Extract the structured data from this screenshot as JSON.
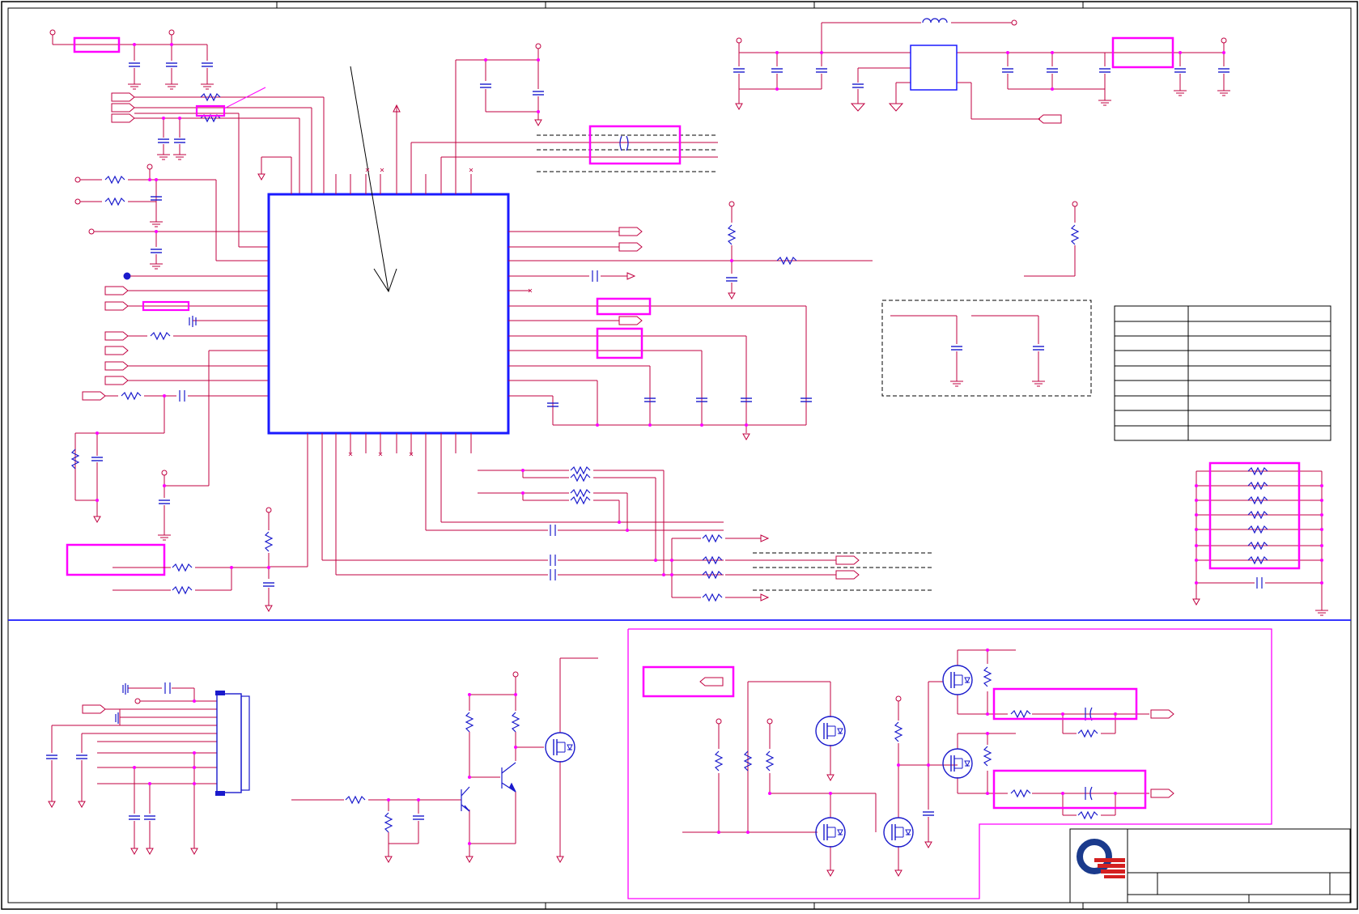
{
  "colors": {
    "wire": "#c00040",
    "node": "#ff00ff",
    "component": "#1a1acc",
    "highlight": "#ff00ff",
    "border": "#000000",
    "divider": "#1a1aff",
    "logo_blue": "#1a3a8c",
    "logo_red": "#d42020"
  },
  "title_block": {
    "logo_icon": "company-logo-icon"
  }
}
